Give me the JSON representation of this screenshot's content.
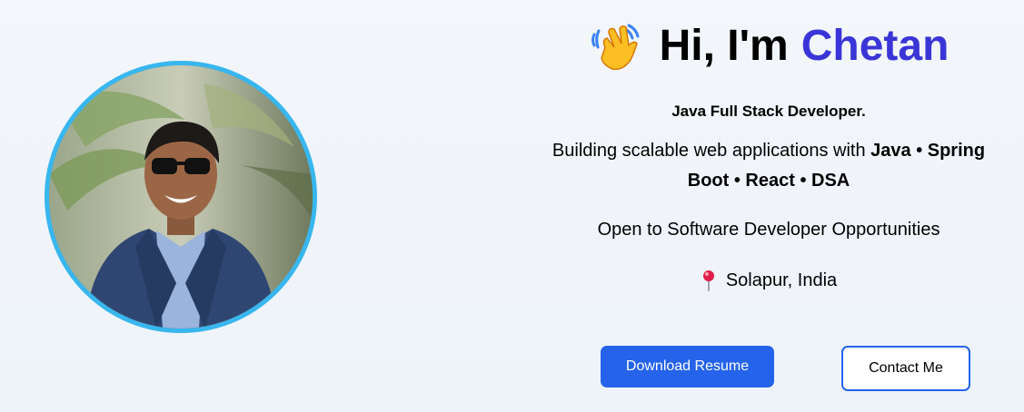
{
  "hero": {
    "greeting": "Hi, I'm",
    "name": "Chetan",
    "name_color": "#3a35d6",
    "icon": "waving-hand-icon"
  },
  "role": "Java Full Stack Developer.",
  "tagline": {
    "prefix": "Building scalable web applications with",
    "tech": "Java • Spring Boot • React • DSA"
  },
  "availability": "Open to Software Developer Opportunities",
  "location": {
    "icon": "map-pin-icon",
    "text": "Solapur, India"
  },
  "actions": {
    "download_resume": "Download Resume",
    "contact": "Contact Me"
  },
  "colors": {
    "primary": "#2563eb",
    "avatar_border": "#38b6ee"
  }
}
